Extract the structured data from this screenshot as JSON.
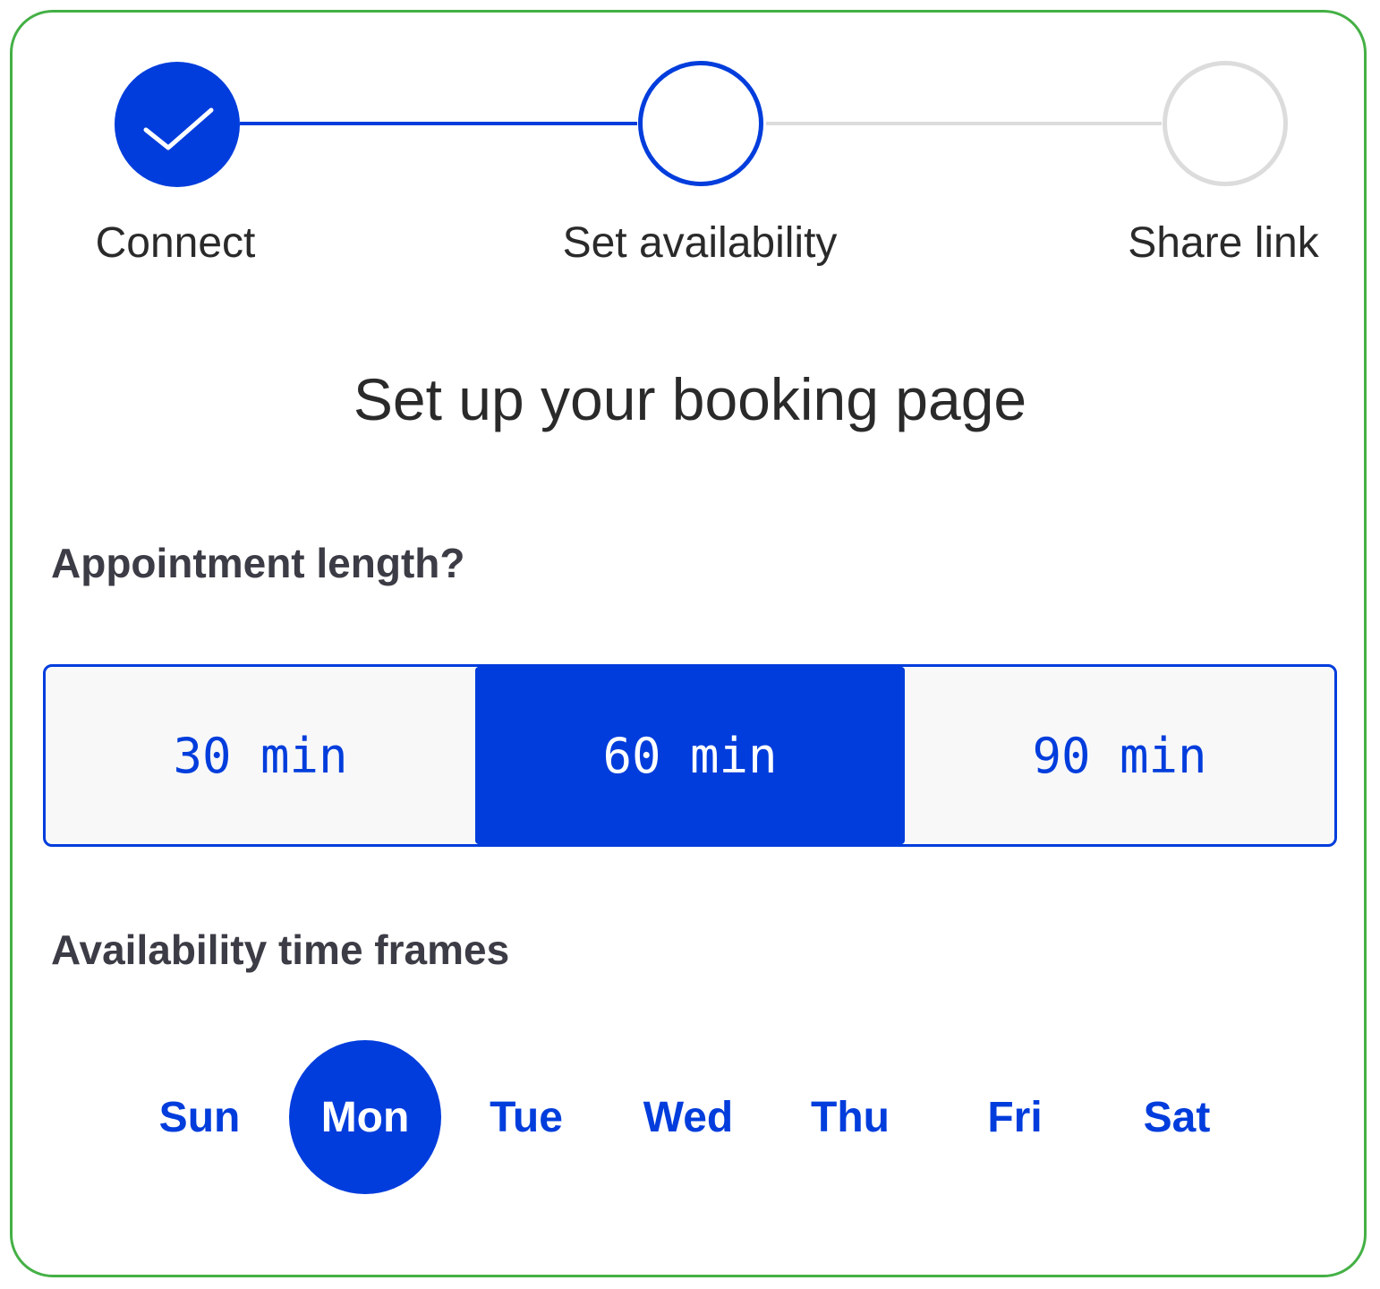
{
  "stepper": {
    "steps": [
      {
        "label": "Connect",
        "state": "completed",
        "icon": "check-icon"
      },
      {
        "label": "Set availability",
        "state": "active"
      },
      {
        "label": "Share link",
        "state": "pending"
      }
    ]
  },
  "title": "Set up your booking page",
  "appointment": {
    "label": "Appointment length?",
    "options": [
      "30 min",
      "60 min",
      "90 min"
    ],
    "selected": "60 min"
  },
  "availability": {
    "label": "Availability time frames",
    "days": [
      "Sun",
      "Mon",
      "Tue",
      "Wed",
      "Thu",
      "Fri",
      "Sat"
    ],
    "selected": "Mon"
  },
  "colors": {
    "accent": "#003ddc",
    "border": "#44b045",
    "inactive": "#dcdcdc",
    "text": "#2a2a2a"
  }
}
